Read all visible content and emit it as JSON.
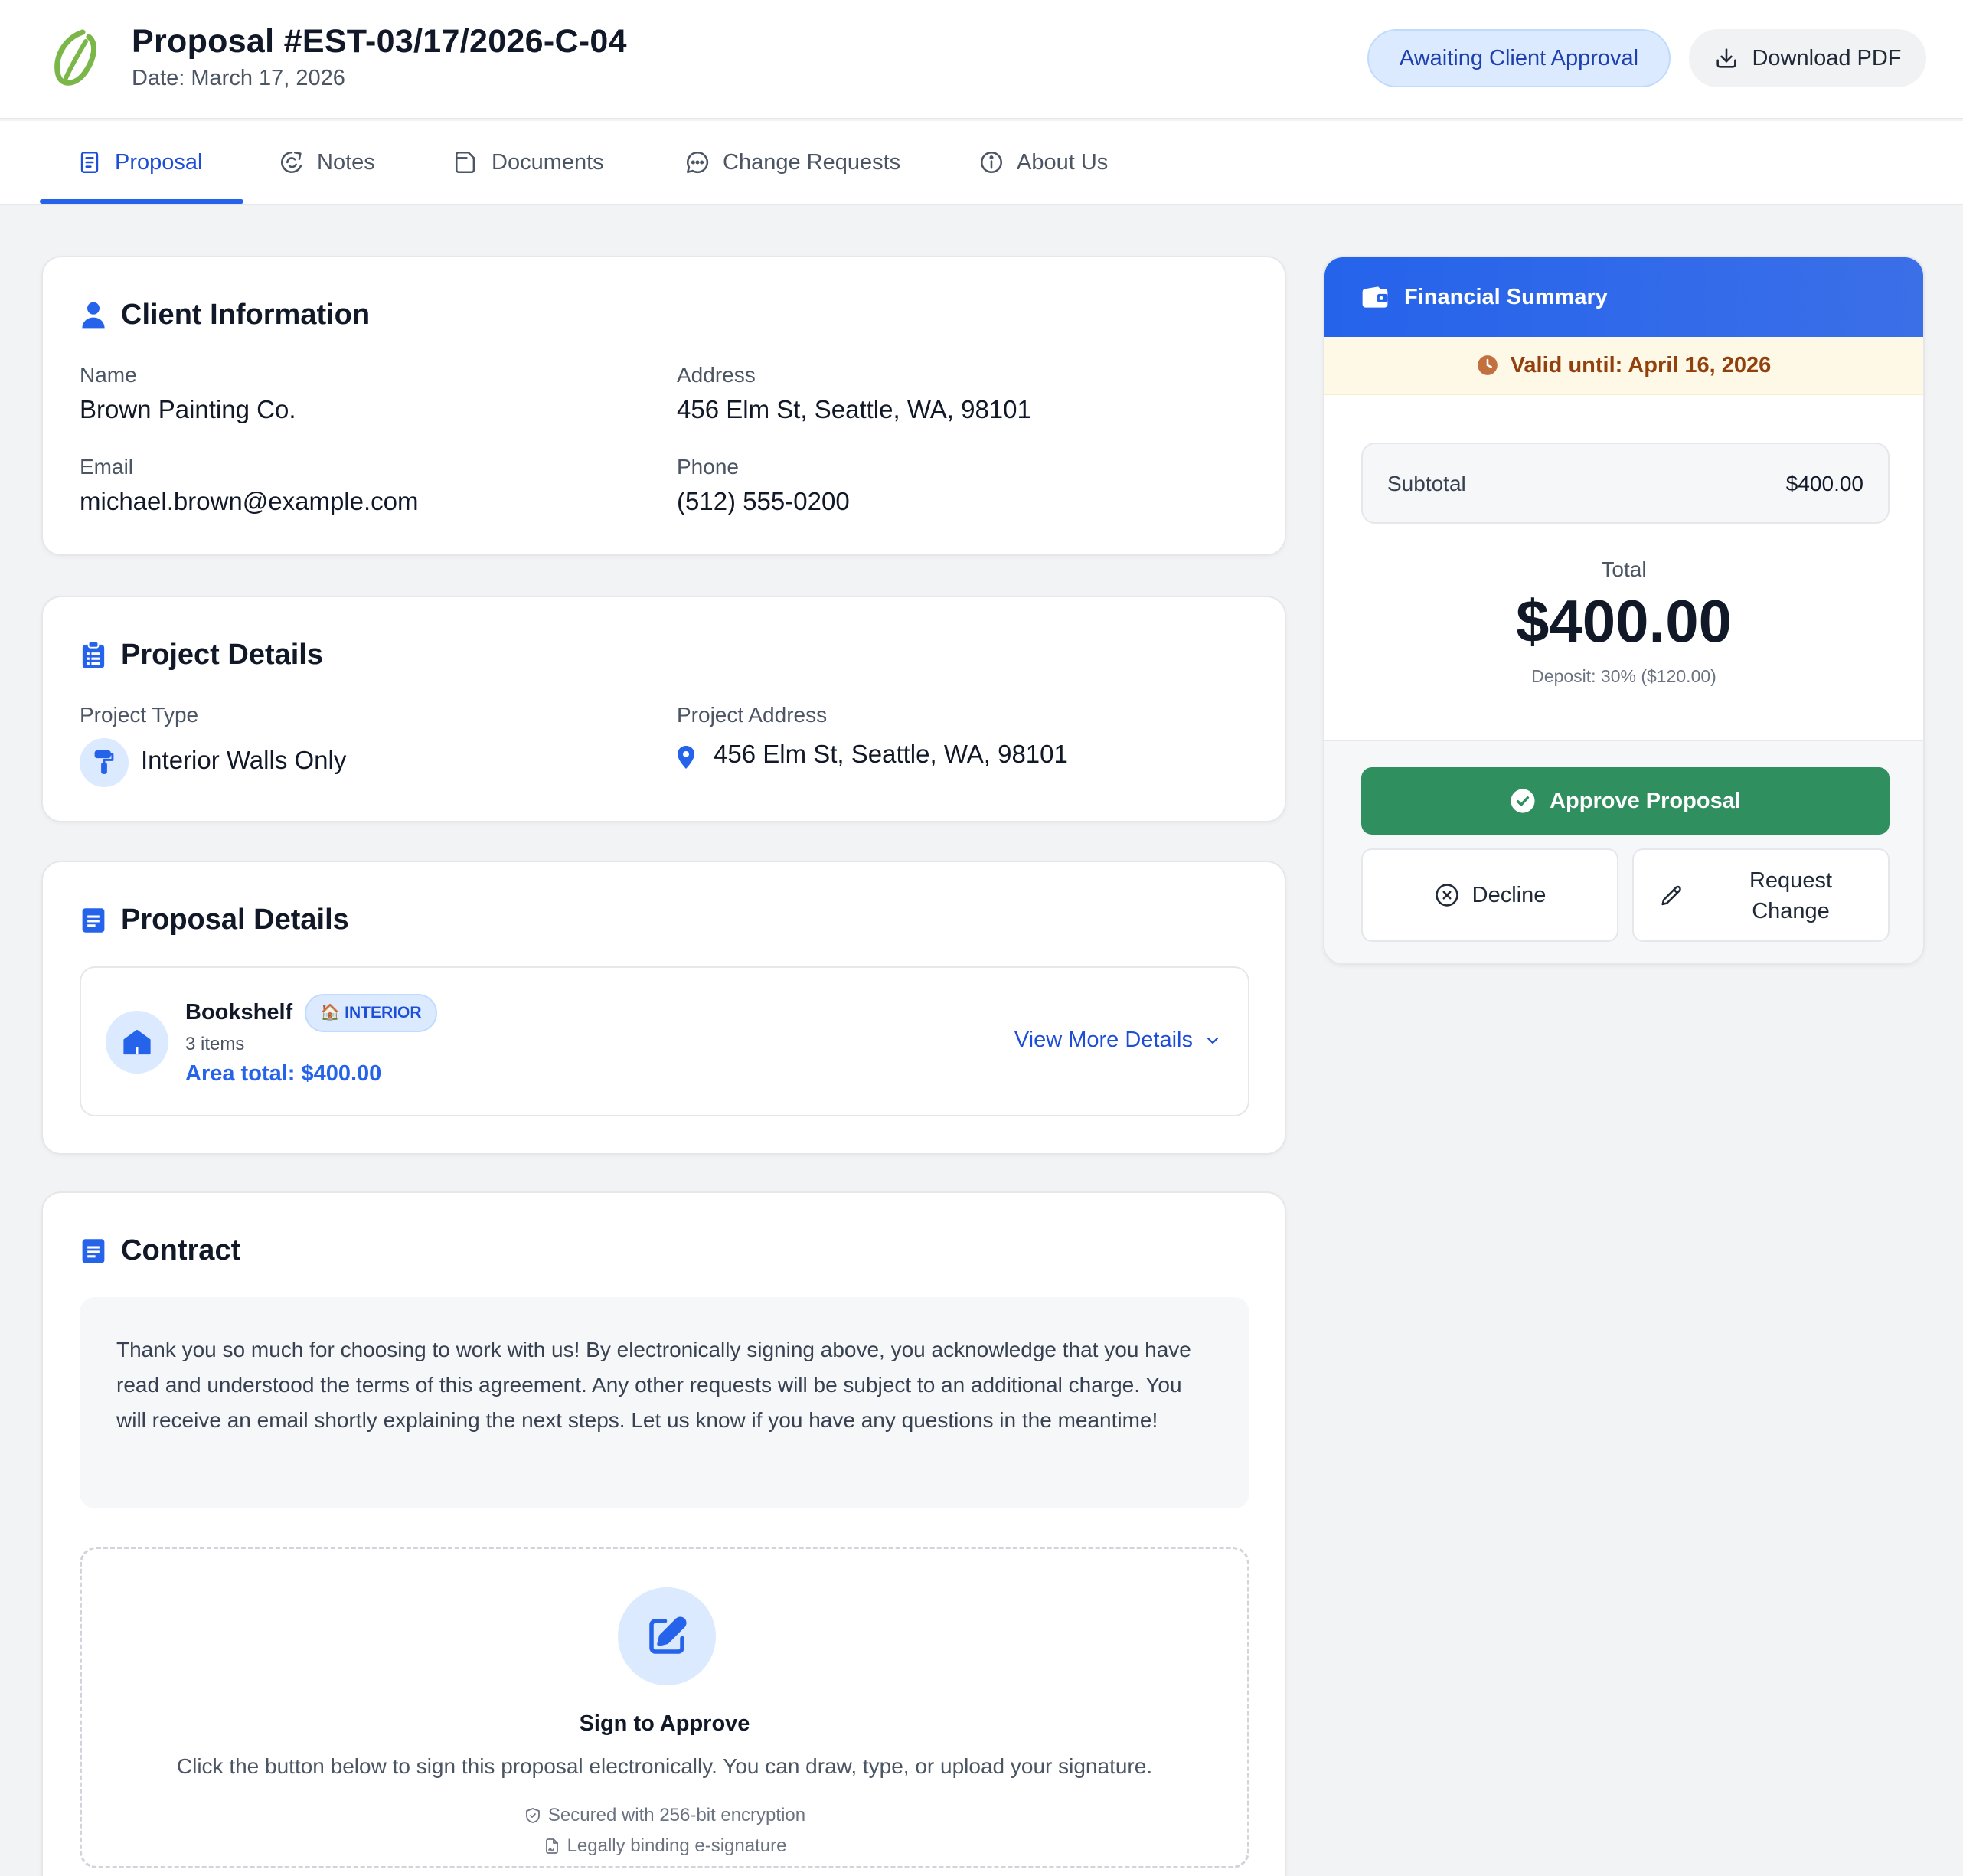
{
  "header": {
    "title": "Proposal #EST-03/17/2026-C-04",
    "date": "Date: March 17, 2026",
    "status": "Awaiting Client Approval",
    "download_label": "Download PDF"
  },
  "tabs": [
    {
      "label": "Proposal",
      "icon": "document-icon",
      "active": true
    },
    {
      "label": "Notes",
      "icon": "notes-icon"
    },
    {
      "label": "Documents",
      "icon": "folder-icon"
    },
    {
      "label": "Change Requests",
      "icon": "chat-bubble-icon"
    },
    {
      "label": "About Us",
      "icon": "info-icon"
    }
  ],
  "client": {
    "title": "Client Information",
    "name_label": "Name",
    "name": "Brown Painting Co.",
    "address_label": "Address",
    "address": "456 Elm St, Seattle, WA, 98101",
    "email_label": "Email",
    "email": "michael.brown@example.com",
    "phone_label": "Phone",
    "phone": "(512) 555-0200"
  },
  "project": {
    "title": "Project Details",
    "type_label": "Project Type",
    "type": "Interior Walls Only",
    "address_label": "Project Address",
    "address": "456 Elm St, Seattle, WA, 98101"
  },
  "proposal": {
    "title": "Proposal Details",
    "area": {
      "name": "Bookshelf",
      "tag": "INTERIOR",
      "count": "3 items",
      "total": "Area total: $400.00",
      "view_more": "View More Details"
    }
  },
  "contract": {
    "title": "Contract",
    "text": "Thank you so much for choosing to work with us! By electronically signing above, you acknowledge that you have read and understood the terms of this agreement. Any other requests will be subject to an additional charge. You will receive an email shortly explaining the next steps. Let us know if you have any questions in the meantime!",
    "sign_title": "Sign to Approve",
    "sign_desc": "Click the button below to sign this proposal electronically. You can draw, type, or upload your signature.",
    "note_secure": "Secured with 256-bit encryption",
    "note_legal": "Legally binding e-signature"
  },
  "financial": {
    "title": "Financial Summary",
    "valid_until": "Valid until: April 16, 2026",
    "subtotal_label": "Subtotal",
    "subtotal": "$400.00",
    "total_label": "Total",
    "total": "$400.00",
    "deposit": "Deposit: 30% ($120.00)",
    "approve_label": "Approve Proposal",
    "decline_label": "Decline",
    "request_change_label": "Request Change"
  },
  "colors": {
    "accent": "#2563eb",
    "approve": "#2f8f5f",
    "status_bg": "#dbeafe",
    "warning_text": "#92400e",
    "logo": "#7ab648"
  }
}
